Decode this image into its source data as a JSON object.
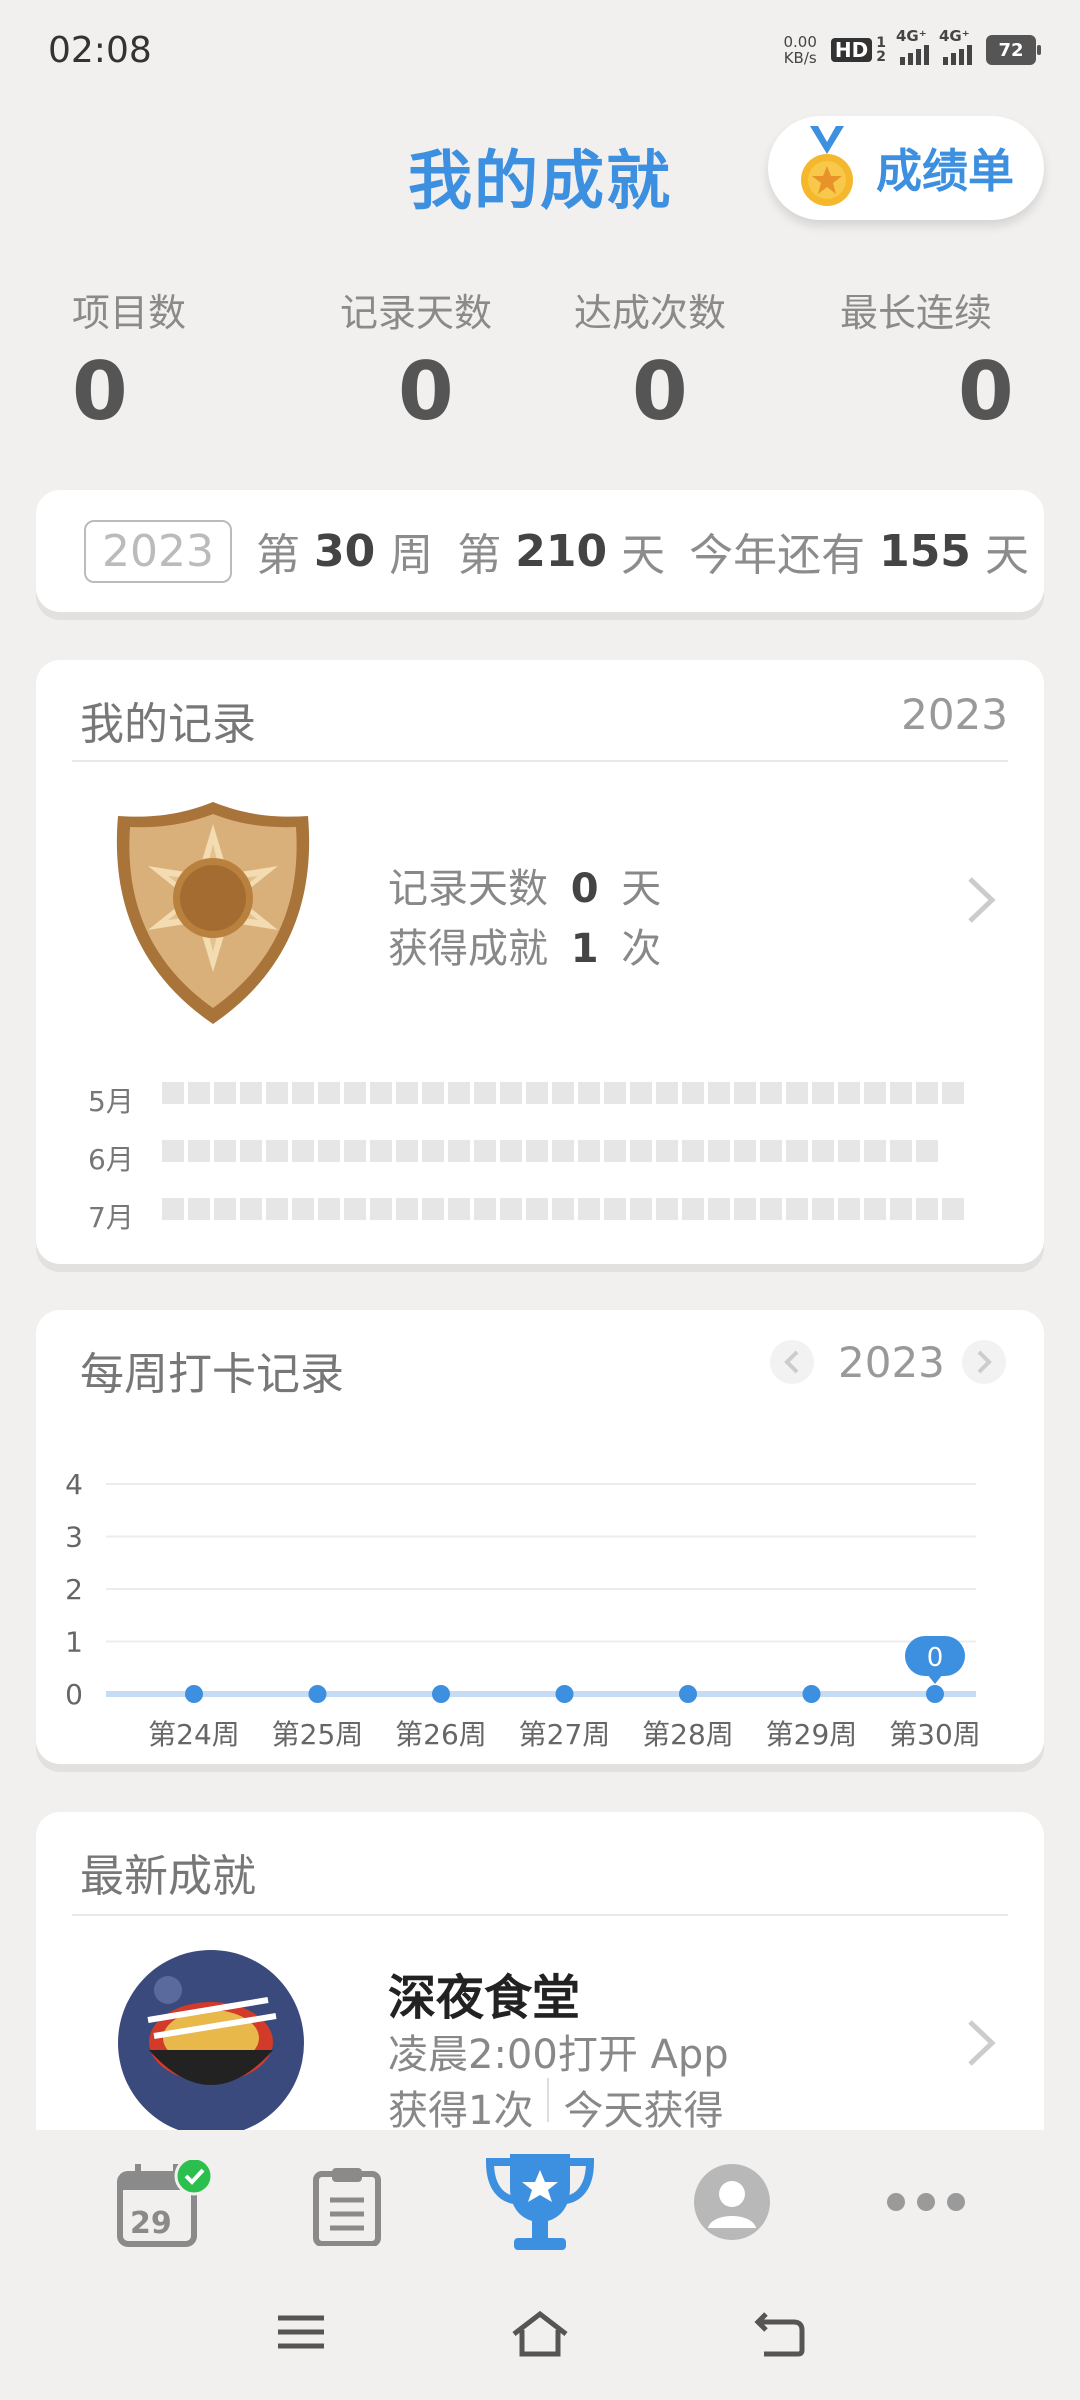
{
  "status": {
    "time": "02:08",
    "net_speed_value": "0.00",
    "net_speed_unit": "KB/s",
    "hd": "HD",
    "sim1": "1",
    "sim2": "2",
    "net1": "4G⁺",
    "net2": "4G⁺",
    "battery": "72"
  },
  "header": {
    "title": "我的成就",
    "report_button": "成绩单"
  },
  "stats": [
    {
      "label": "项目数",
      "value": "0"
    },
    {
      "label": "记录天数",
      "value": "0"
    },
    {
      "label": "达成次数",
      "value": "0"
    },
    {
      "label": "最长连续",
      "value": "0"
    }
  ],
  "week_info": {
    "year": "2023",
    "w_prefix": "第",
    "week": "30",
    "w_suffix": "周",
    "d_prefix": "第",
    "day": "210",
    "d_suffix": "天",
    "remain_prefix": "今年还有",
    "remain": "155",
    "remain_suffix": "天"
  },
  "records": {
    "title": "我的记录",
    "year": "2023",
    "days_label": "记录天数",
    "days_value": "0",
    "days_unit": "天",
    "ach_label": "获得成就",
    "ach_value": "1",
    "ach_unit": "次",
    "months": [
      "5月",
      "6月",
      "7月"
    ]
  },
  "weekly": {
    "title": "每周打卡记录",
    "year": "2023",
    "bubble": "0"
  },
  "chart_data": {
    "type": "line",
    "categories": [
      "第24周",
      "第25周",
      "第26周",
      "第27周",
      "第28周",
      "第29周",
      "第30周"
    ],
    "values": [
      0,
      0,
      0,
      0,
      0,
      0,
      0
    ],
    "yticks": [
      "0",
      "1",
      "2",
      "3",
      "4"
    ],
    "ylim": [
      0,
      4
    ],
    "grid": true,
    "line_color": "#c6dcf5",
    "point_color": "#3d8fe0"
  },
  "latest": {
    "title": "最新成就",
    "name": "深夜食堂",
    "desc": "凌晨2:00打开 App",
    "count": "获得1次",
    "when": "今天获得"
  },
  "nav": {
    "calendar_day": "29",
    "accent": "#3d8fe0"
  },
  "colors": {
    "accent": "#3d8fe0",
    "check_green": "#2bbf4d",
    "badge_bronze": "#c79a5a"
  }
}
